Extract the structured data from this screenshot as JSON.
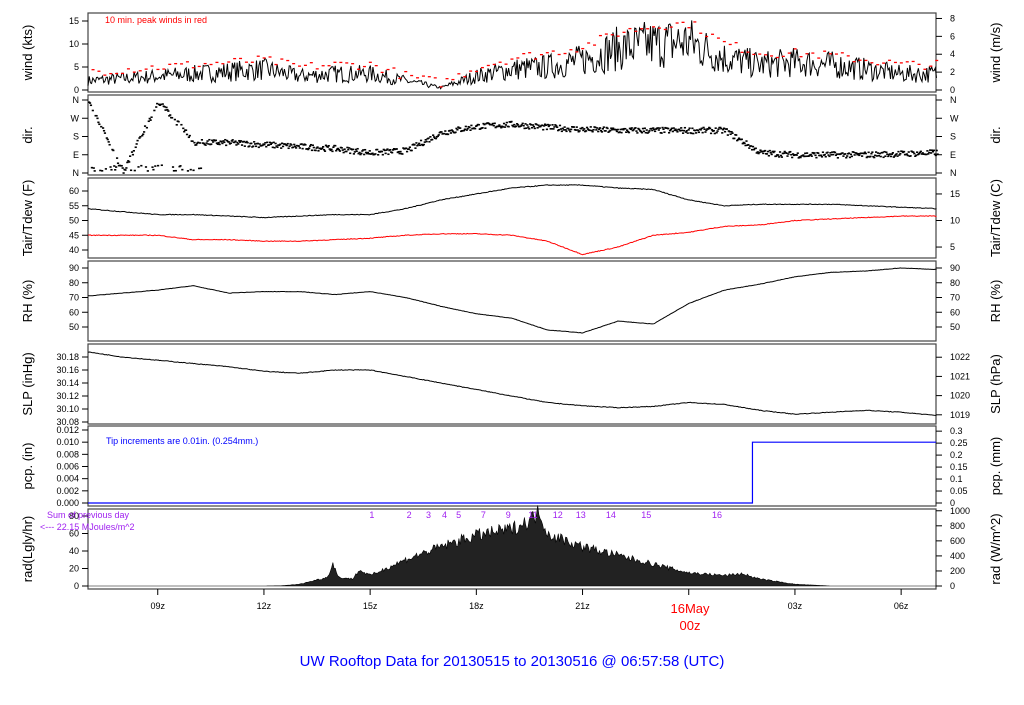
{
  "chart_data": {
    "type": "line",
    "title": "UW Rooftop Data for 20130515  to  20130516 @ 06:57:58  (UTC)",
    "x_unit": "hours UTC since 20130515 00z",
    "xlim": [
      7.03,
      31.0
    ],
    "x_ticks": [
      {
        "h": 9,
        "label": "09z"
      },
      {
        "h": 12,
        "label": "12z"
      },
      {
        "h": 15,
        "label": "15z"
      },
      {
        "h": 18,
        "label": "18z"
      },
      {
        "h": 21,
        "label": "21z"
      },
      {
        "h": 24,
        "label": "00z"
      },
      {
        "h": 27,
        "label": "03z"
      },
      {
        "h": 30,
        "label": "06z"
      }
    ],
    "date_label": "16May",
    "date_label_color": "#ff0000",
    "hours": [
      7,
      8,
      9,
      10,
      11,
      12,
      13,
      14,
      15,
      16,
      17,
      18,
      19,
      20,
      21,
      22,
      23,
      24,
      25,
      26,
      27,
      28,
      29,
      30,
      31
    ],
    "panels": {
      "wind": {
        "ylabel": "wind (kts)",
        "ylabel_right": "wind (m/s)",
        "note": "10 min. peak winds in red",
        "note_color": "#ff0000",
        "ylim": [
          0,
          15
        ],
        "left_ticks": [
          "0",
          "5",
          "10",
          "15"
        ],
        "left_tick_values": [
          0,
          5,
          10,
          15
        ],
        "right_ticks": [
          "0",
          "2",
          "4",
          "6",
          "8"
        ],
        "right_tick_values_ms": [
          0,
          2,
          4,
          6,
          8
        ],
        "series": [
          {
            "name": "wind",
            "color": "#000000",
            "values": [
              2,
              2.5,
              3,
              3.5,
              4,
              4.5,
              3,
              3.5,
              3.5,
              2,
              0.5,
              3,
              4.5,
              5,
              6.5,
              9,
              10,
              10.5,
              7,
              5.5,
              6,
              5.5,
              4.5,
              3.5,
              3.5
            ]
          },
          {
            "name": "peak",
            "color": "#ff0000",
            "values": [
              4,
              4.5,
              5,
              5.5,
              6,
              6.5,
              5,
              5.5,
              5.5,
              3,
              1.5,
              5,
              7,
              8,
              9.5,
              12.5,
              14,
              14.5,
              10,
              8,
              8,
              7.5,
              6.5,
              5.5,
              5.5
            ]
          }
        ]
      },
      "dir": {
        "ylabel": "dir.",
        "ylabel_right": "dir.",
        "ticks": [
          "N",
          "E",
          "S",
          "W",
          "N"
        ],
        "tick_values": [
          0,
          90,
          180,
          270,
          360
        ],
        "values": [
          355,
          10,
          355,
          150,
          150,
          140,
          130,
          120,
          100,
          110,
          200,
          230,
          240,
          225,
          215,
          210,
          210,
          210,
          210,
          100,
          90,
          90,
          90,
          95,
          100
        ]
      },
      "temp": {
        "ylabel": "Tair/Tdew (F)",
        "ylabel_right": "Tair/Tdew (C)",
        "left_ticks": [
          "40",
          "45",
          "50",
          "55",
          "60"
        ],
        "left_tick_values": [
          40,
          45,
          50,
          55,
          60
        ],
        "right_ticks": [
          "5",
          "10",
          "15"
        ],
        "right_tick_values_c": [
          5,
          10,
          15
        ],
        "series": [
          {
            "name": "Tair",
            "color": "#000000",
            "values": [
              54,
              53,
              52,
              52,
              51.5,
              51,
              51.5,
              52,
              52,
              54,
              57,
              59,
              61,
              62,
              62,
              61,
              60.5,
              57,
              55,
              55.5,
              55.5,
              55.5,
              55,
              54.5,
              54
            ]
          },
          {
            "name": "Tdew",
            "color": "#ff0000",
            "values": [
              45,
              45,
              45,
              43.5,
              43.5,
              43,
              43,
              43.5,
              44,
              45,
              45.5,
              45.5,
              45,
              43,
              38.5,
              41,
              45,
              46,
              48,
              48.5,
              50,
              50.5,
              51,
              51.5,
              51.5
            ]
          }
        ]
      },
      "rh": {
        "ylabel": "RH (%)",
        "ylabel_right": "RH (%)",
        "ticks": [
          "50",
          "60",
          "70",
          "80",
          "90"
        ],
        "tick_values": [
          50,
          60,
          70,
          80,
          90
        ],
        "values": [
          71,
          73,
          75,
          78,
          73,
          74,
          74,
          72,
          74,
          70,
          64,
          59,
          56,
          48,
          46,
          54,
          52,
          66,
          75,
          79,
          84,
          87,
          88,
          90,
          89
        ]
      },
      "slp": {
        "ylabel": "SLP (inHg)",
        "ylabel_right": "SLP (hPa)",
        "left_ticks": [
          "30.08",
          "30.10",
          "30.12",
          "30.14",
          "30.16",
          "30.18"
        ],
        "left_tick_values": [
          30.08,
          30.1,
          30.12,
          30.14,
          30.16,
          30.18
        ],
        "right_ticks": [
          "1019",
          "1020",
          "1021",
          "1022"
        ],
        "right_tick_values_hpa": [
          1019,
          1020,
          1021,
          1022
        ],
        "values": [
          30.188,
          30.18,
          30.175,
          30.17,
          30.165,
          30.158,
          30.155,
          30.16,
          30.16,
          30.15,
          30.14,
          30.13,
          30.12,
          30.11,
          30.105,
          30.102,
          30.104,
          30.11,
          30.107,
          30.098,
          30.092,
          30.095,
          30.098,
          30.095,
          30.09
        ]
      },
      "pcp": {
        "ylabel": "pcp. (in)",
        "ylabel_right": "pcp. (mm)",
        "note": "Tip increments are 0.01in. (0.254mm.)",
        "note_color": "#0000ff",
        "left_ticks": [
          "0.000",
          "0.002",
          "0.004",
          "0.006",
          "0.008",
          "0.010",
          "0.012"
        ],
        "left_tick_values": [
          0,
          0.002,
          0.004,
          0.006,
          0.008,
          0.01,
          0.012
        ],
        "right_ticks": [
          "0",
          "0.05",
          "0.1",
          "0.15",
          "0.2",
          "0.25",
          "0.3"
        ],
        "right_tick_values_mm": [
          0,
          0.05,
          0.1,
          0.15,
          0.2,
          0.25,
          0.3
        ],
        "step_hour": 25.8,
        "before": 0.0,
        "after": 0.01,
        "color": "#0000ff"
      },
      "rad": {
        "ylabel": "rad(Lgly/hr)",
        "ylabel_right": "rad (W/m^2)",
        "note_line1": "Sum of previous day",
        "note_line2": "<--- 22.15 MJoules/m^2",
        "note_color": "#a020f0",
        "left_ticks": [
          "0",
          "20",
          "40",
          "60",
          "80"
        ],
        "left_tick_values": [
          0,
          20,
          40,
          60,
          80
        ],
        "right_ticks": [
          "0",
          "200",
          "400",
          "600",
          "800",
          "1000"
        ],
        "right_tick_values_wm2": [
          0,
          200,
          400,
          600,
          800,
          1000
        ],
        "hours": [
          7,
          12,
          12.5,
          13,
          13.8,
          13.95,
          14.1,
          14.5,
          14.7,
          15,
          16,
          17,
          18,
          19,
          19.5,
          19.8,
          20,
          21,
          22,
          23,
          24,
          25,
          25.5,
          26,
          27,
          28,
          31
        ],
        "values": [
          0,
          0,
          0.3,
          2,
          10,
          26,
          10,
          8,
          18,
          12,
          30,
          45,
          58,
          65,
          75,
          85,
          60,
          45,
          35,
          25,
          15,
          12,
          14,
          8,
          2,
          0,
          0
        ],
        "hour_marks": [
          {
            "h": 15.05,
            "label": "1"
          },
          {
            "h": 16.1,
            "label": "2"
          },
          {
            "h": 16.65,
            "label": "3"
          },
          {
            "h": 17.1,
            "label": "4"
          },
          {
            "h": 17.5,
            "label": "5"
          },
          {
            "h": 18.2,
            "label": "7"
          },
          {
            "h": 18.9,
            "label": "9"
          },
          {
            "h": 19.6,
            "label": "11"
          },
          {
            "h": 20.3,
            "label": "12"
          },
          {
            "h": 20.95,
            "label": "13"
          },
          {
            "h": 21.8,
            "label": "14"
          },
          {
            "h": 22.8,
            "label": "15"
          },
          {
            "h": 24.8,
            "label": "16"
          }
        ],
        "hour_mark_color": "#a020f0"
      }
    }
  }
}
